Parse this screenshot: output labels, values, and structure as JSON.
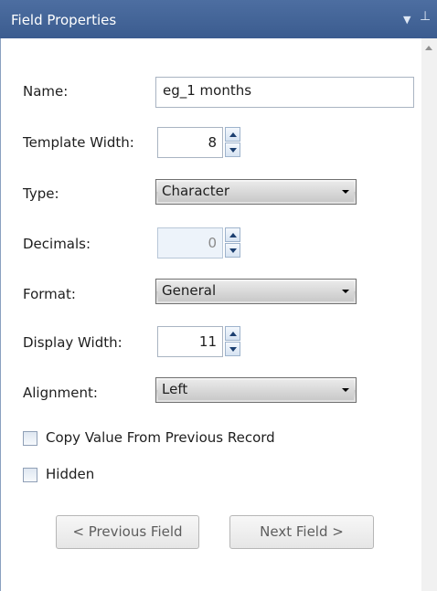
{
  "window": {
    "title": "Field Properties",
    "dropdown_icon": "dropdown-arrow-icon",
    "pin_icon": "pin-icon"
  },
  "fields": {
    "name": {
      "label": "Name:",
      "value": "eg_1 months"
    },
    "template_width": {
      "label": "Template Width:",
      "value": "8"
    },
    "type": {
      "label": "Type:",
      "value": "Character"
    },
    "decimals": {
      "label": "Decimals:",
      "value": "0"
    },
    "format": {
      "label": "Format:",
      "value": "General"
    },
    "display_width": {
      "label": "Display Width:",
      "value": "11"
    },
    "alignment": {
      "label": "Alignment:",
      "value": "Left"
    }
  },
  "checkboxes": {
    "copy_value": {
      "label": "Copy Value From Previous Record",
      "checked": false
    },
    "hidden": {
      "label": "Hidden",
      "checked": false
    }
  },
  "buttons": {
    "previous": "< Previous Field",
    "next": "Next Field >"
  },
  "colors": {
    "titlebar": "#3b5c8f",
    "title_text": "#ffffff"
  }
}
